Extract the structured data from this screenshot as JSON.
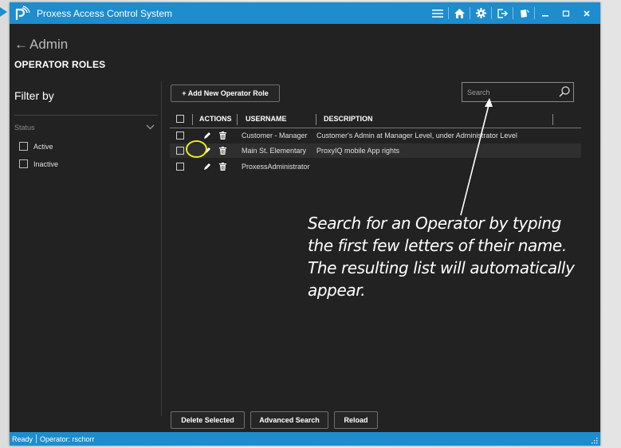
{
  "window": {
    "title": "Proxess Access Control System",
    "accent_color": "#1e8ccd",
    "title_icons": [
      "menu-icon",
      "home-icon",
      "gear-icon",
      "logout-icon",
      "badge-icon",
      "minimize-icon",
      "maximize-icon",
      "close-icon"
    ]
  },
  "header": {
    "back_label": "Admin",
    "page_title": "OPERATOR ROLES"
  },
  "filter": {
    "title": "Filter by",
    "status_label": "Status",
    "options": [
      {
        "label": "Active",
        "checked": false
      },
      {
        "label": "Inactive",
        "checked": false
      }
    ]
  },
  "toolbar": {
    "add_label": "+ Add New Operator Role",
    "search_placeholder": "Search"
  },
  "table": {
    "columns": [
      "ACTIONS",
      "USERNAME",
      "DESCRIPTION"
    ],
    "rows": [
      {
        "username": "Customer - Manager",
        "description": "Customer's Admin at Manager Level, under Administrator Level"
      },
      {
        "username": "Main St. Elementary",
        "description": "ProxyIQ mobile App rights",
        "selected": true
      },
      {
        "username": "ProxessAdministrator",
        "description": ""
      }
    ]
  },
  "annotation": {
    "text": "Search for an Operator by typing the first few letters of their name. The resulting list will automatically appear.",
    "highlight_color": "#f2ec1c"
  },
  "footer_buttons": {
    "delete_label": "Delete Selected",
    "advanced_label": "Advanced Search",
    "reload_label": "Reload"
  },
  "status": {
    "state": "Ready",
    "operator": "Operator: rschorr"
  }
}
